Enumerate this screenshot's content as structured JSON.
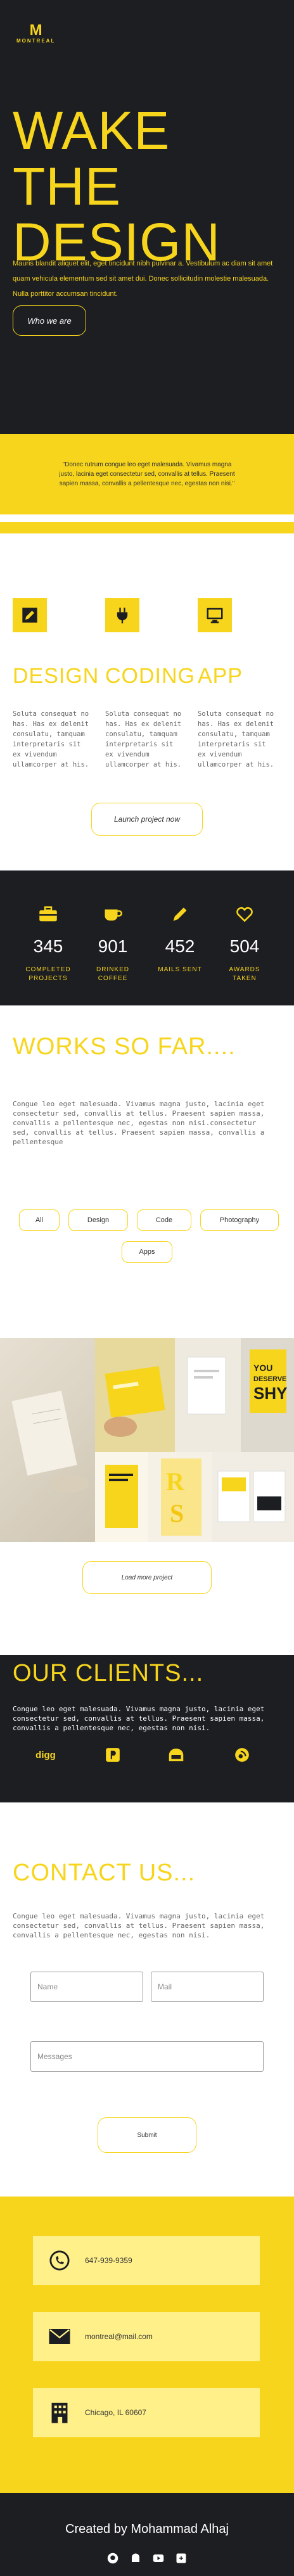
{
  "brand": {
    "letter": "M",
    "name": "MONTREAL"
  },
  "hero": {
    "title_line1": "WAKE THE",
    "title_line2": "DESIGN",
    "text": "Mauris blandit aliquet elit, eget tincidunt nibh pulvinar a. Vestibulum ac diam sit amet quam vehicula elementum sed sit amet dui. Donec sollicitudin molestie malesuada. Nulla porttitor accumsan tincidunt.",
    "button": "Who we are"
  },
  "quote": "\"Donec rutrum congue leo eget malesuada. Vivamus magna justo, lacinia eget consectetur sed, convallis at tellus. Praesent sapien massa, convallis a pellentesque nec, egestas non nisi.\"",
  "services": {
    "items": [
      {
        "icon": "pencil-square-icon",
        "title": "DESIGN",
        "text": "Soluta consequat no has. Has ex delenit consulatu, tamquam interpretaris sit ex vivendum ullamcorper at his."
      },
      {
        "icon": "plug-icon",
        "title": "CODING",
        "text": "Soluta consequat no has. Has ex delenit consulatu, tamquam interpretaris sit ex vivendum ullamcorper at his."
      },
      {
        "icon": "monitor-icon",
        "title": "APP",
        "text": "Soluta consequat no has. Has ex delenit consulatu, tamquam interpretaris sit ex vivendum ullamcorper at his."
      }
    ],
    "button": "Launch project now"
  },
  "stats": [
    {
      "icon": "briefcase-icon",
      "value": "345",
      "label_line1": "COMPLETED",
      "label_line2": "PROJECTS"
    },
    {
      "icon": "coffee-icon",
      "value": "901",
      "label_line1": "DRINKED",
      "label_line2": "COFFEE"
    },
    {
      "icon": "pencil-icon",
      "value": "452",
      "label_line1": "MAILS SENT",
      "label_line2": ""
    },
    {
      "icon": "heart-icon",
      "value": "504",
      "label_line1": "AWARDS TAKEN",
      "label_line2": ""
    }
  ],
  "works": {
    "title": "WORKS SO FAR....",
    "text": "Congue leo eget malesuada. Vivamus magna justo, lacinia eget consectetur sed, convallis at tellus. Praesent sapien massa, convallis a pellentesque nec, egestas non nisi.consectetur sed, convallis at tellus. Praesent sapien massa, convallis a pellentesque",
    "filters": [
      "All",
      "Design",
      "Code",
      "Photography",
      "Apps"
    ],
    "load_button": "Load more project",
    "book_text": "YOU DESERVE SHY"
  },
  "clients": {
    "title": "OUR CLIENTS...",
    "text": "Congue leo eget malesuada. Vivamus magna justo, lacinia eget consectetur sed, convallis at tellus. Praesent sapien massa, convallis a pellentesque nec, egestas non nisi.",
    "logos": [
      "digg",
      "product-hunt-icon",
      "octocat-icon",
      "podcast-icon"
    ]
  },
  "contact": {
    "title": "CONTACT US...",
    "text": "Congue leo eget malesuada. Vivamus magna justo, lacinia eget consectetur sed, convallis at tellus. Praesent sapien massa, convallis a pellentesque nec, egestas non nisi.",
    "name_placeholder": "Name",
    "mail_placeholder": "Mail",
    "messages_placeholder": "Messages",
    "submit": "Submit"
  },
  "info": {
    "phone": "647-939-9359",
    "email": "montreal@mail.com",
    "address": "Chicago, IL 60607"
  },
  "footer": {
    "credit": "Created by Mohammad Alhaj",
    "social": [
      "github-icon",
      "github-alt-icon",
      "youtube-icon",
      "google-plus-icon"
    ]
  },
  "colors": {
    "accent": "#f7d51d",
    "dark": "#1d1e22",
    "card": "#fff08a"
  }
}
